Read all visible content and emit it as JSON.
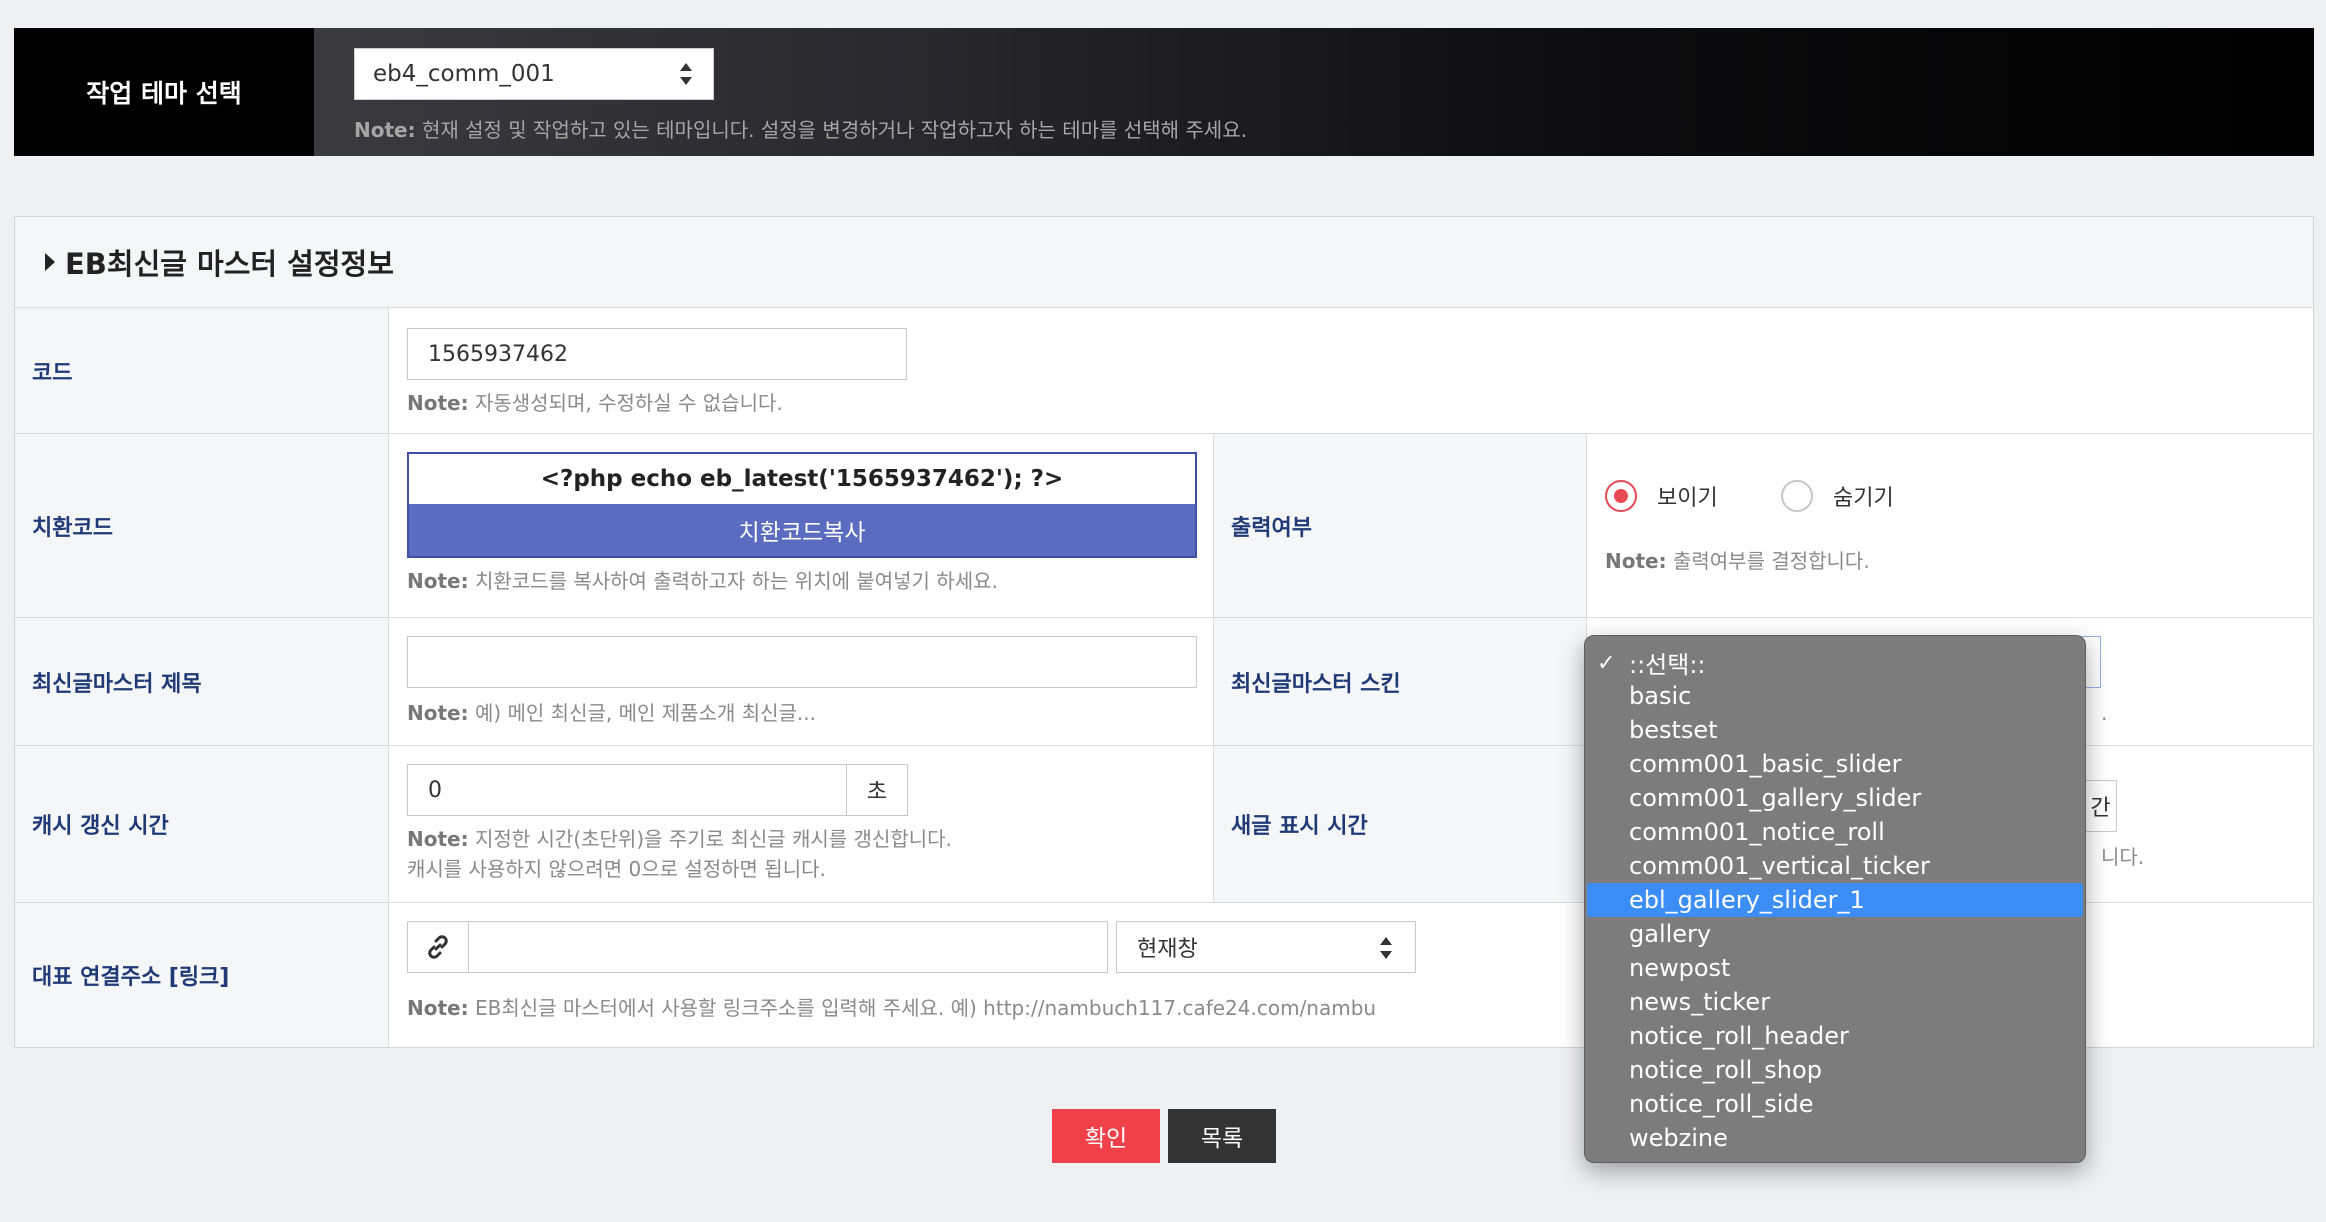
{
  "theme_bar": {
    "label": "작업 테마 선택",
    "selected_theme": "eb4_comm_001",
    "note_prefix": "Note:",
    "note_text": " 현재 설정 및 작업하고 있는 테마입니다. 설정을 변경하거나 작업하고자 하는 테마를 선택해 주세요."
  },
  "panel": {
    "title": "EB최신글 마스터 설정정보"
  },
  "rows": {
    "code": {
      "label": "코드",
      "value": "1565937462",
      "note_prefix": "Note:",
      "note_text": " 자동생성되며, 수정하실 수 없습니다."
    },
    "replace": {
      "label": "치환코드",
      "code": "<?php echo eb_latest('1565937462'); ?>",
      "copy_label": "치환코드복사",
      "note_prefix": "Note:",
      "note_text": " 치환코드를 복사하여 출력하고자 하는 위치에 붙여넣기 하세요."
    },
    "output": {
      "label": "출력여부",
      "show_label": "보이기",
      "hide_label": "숨기기",
      "note_prefix": "Note:",
      "note_text": " 출력여부를 결정합니다."
    },
    "title": {
      "label": "최신글마스터 제목",
      "value": "",
      "note_prefix": "Note:",
      "note_text": " 예) 메인 최신글, 메인 제품소개 최신글..."
    },
    "skin": {
      "label": "최신글마스터 스킨",
      "note_tail": "."
    },
    "cache": {
      "label": "캐시 갱신 시간",
      "value": "0",
      "unit": "초",
      "note_prefix": "Note:",
      "note_text": " 지정한 시간(초단위)을 주기로 최신글 캐시를 갱신합니다.",
      "note_line2": "캐시를 사용하지 않으려면 0으로 설정하면 됩니다."
    },
    "newpost": {
      "label": "새글 표시 시간",
      "addon_tail": "간",
      "note_tail": "니다."
    },
    "link": {
      "label": "대표 연결주소 [링크]",
      "value": "",
      "target": "현재창",
      "note_prefix": "Note:",
      "note_text": " EB최신글 마스터에서 사용할 링크주소를 입력해 주세요. 예) http://nambuch117.cafe24.com/nambu"
    }
  },
  "buttons": {
    "confirm": "확인",
    "list": "목록"
  },
  "skin_dropdown": {
    "check_mark": "✓",
    "options": [
      "::선택::",
      "basic",
      "bestset",
      "comm001_basic_slider",
      "comm001_gallery_slider",
      "comm001_notice_roll",
      "comm001_vertical_ticker",
      "ebl_gallery_slider_1",
      "gallery",
      "newpost",
      "news_ticker",
      "notice_roll_header",
      "notice_roll_shop",
      "notice_roll_side",
      "webzine"
    ],
    "checked": "::선택::",
    "highlighted": "ebl_gallery_slider_1"
  },
  "colors": {
    "label_text": "#1f3a77",
    "copy_button": "#5b6bbf",
    "confirm_button": "#f0414a",
    "list_button": "#333333",
    "radio_on": "#e84a55",
    "dropdown_highlight": "#3c8ef6"
  }
}
